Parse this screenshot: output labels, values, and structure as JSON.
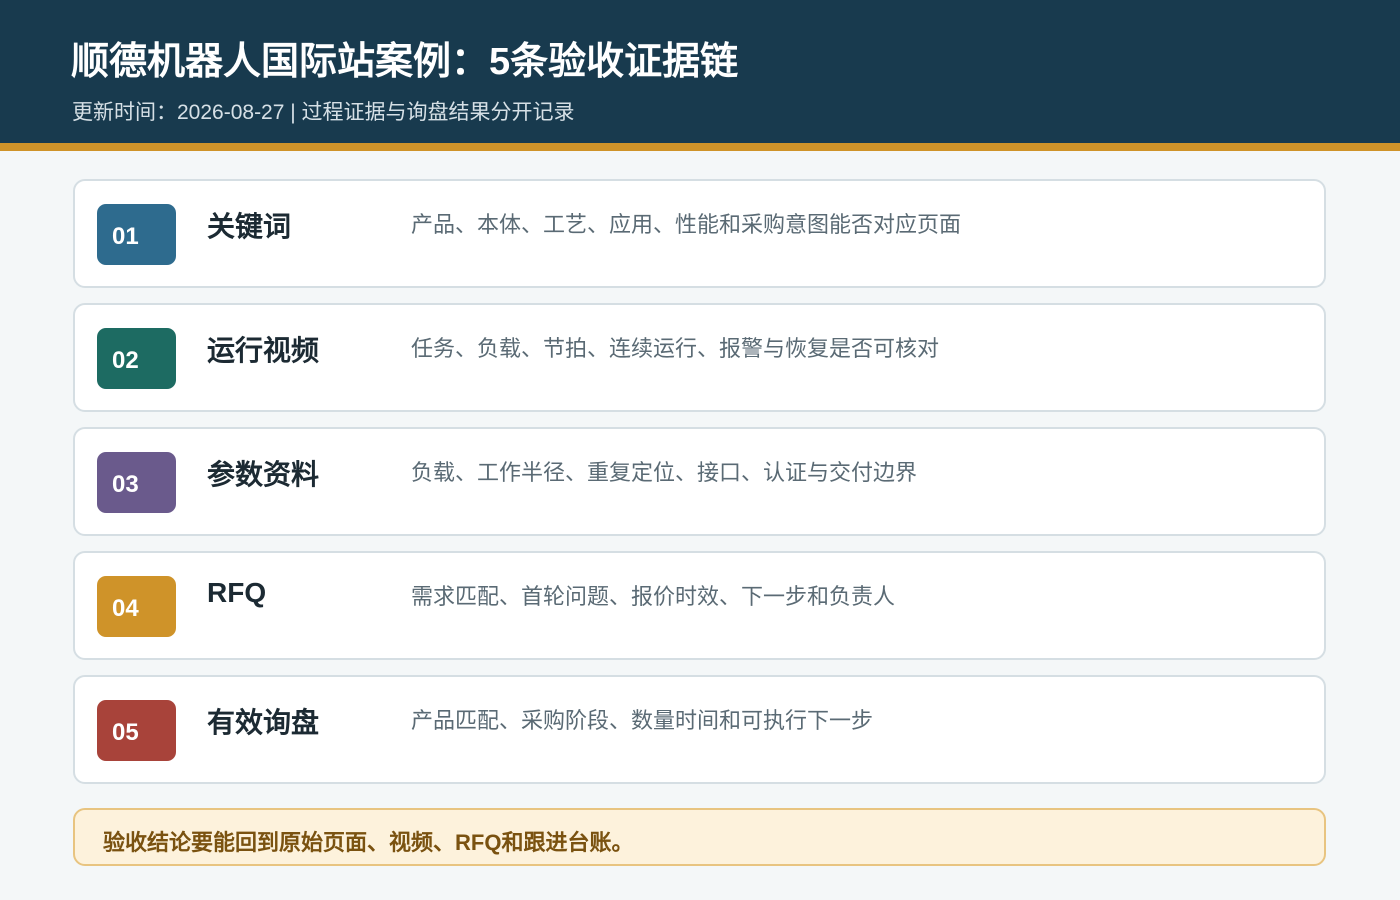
{
  "header": {
    "title": "顺德机器人国际站案例：5条验收证据链",
    "subtitle": "更新时间：2026-08-27 | 过程证据与询盘结果分开记录"
  },
  "colors": {
    "header_bg": "#183a4e",
    "accent": "#cf9329",
    "badge_01": "#2e6b8e",
    "badge_02": "#1d6b62",
    "badge_03": "#6a5a8c",
    "badge_04": "#cf9329",
    "badge_05": "#a8433a",
    "note_bg": "#fdf2dc"
  },
  "cards": [
    {
      "number": "01",
      "title": "关键词",
      "desc": "产品、本体、工艺、应用、性能和采购意图能否对应页面"
    },
    {
      "number": "02",
      "title": "运行视频",
      "desc": "任务、负载、节拍、连续运行、报警与恢复是否可核对"
    },
    {
      "number": "03",
      "title": "参数资料",
      "desc": "负载、工作半径、重复定位、接口、认证与交付边界"
    },
    {
      "number": "04",
      "title": "RFQ",
      "desc": "需求匹配、首轮问题、报价时效、下一步和负责人"
    },
    {
      "number": "05",
      "title": "有效询盘",
      "desc": "产品匹配、采购阶段、数量时间和可执行下一步"
    }
  ],
  "note": {
    "text": "验收结论要能回到原始页面、视频、RFQ和跟进台账。"
  }
}
